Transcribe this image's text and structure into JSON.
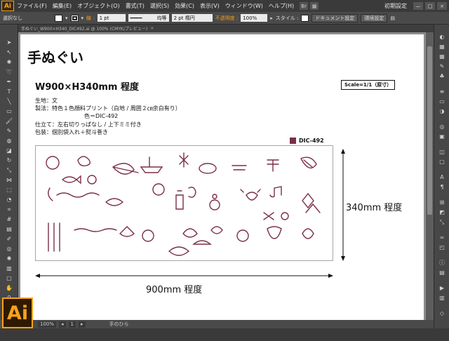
{
  "app": {
    "logo": "Ai",
    "menu": [
      "ファイル(F)",
      "編集(E)",
      "オブジェクト(O)",
      "書式(T)",
      "選択(S)",
      "効果(C)",
      "表示(V)",
      "ウィンドウ(W)",
      "ヘルプ(H)"
    ],
    "workspace": "初期設定",
    "window_buttons": [
      "—",
      "□",
      "×"
    ]
  },
  "control_bar": {
    "selection": "選択なし",
    "stroke_label": "線 :",
    "stroke_weight": "1 pt",
    "stroke_style": "均等",
    "brush": "2 pt 楕円",
    "opacity_label": "不透明度 :",
    "opacity_value": "100%",
    "style_label": "スタイル :",
    "doc_setup": "ドキュメント設定",
    "preferences": "環境設定"
  },
  "tab": {
    "name": "手ぬぐい_W900×H340_DIC492.ai @ 100% (CMYK/プレビュー)"
  },
  "artwork": {
    "title": "手ぬぐい",
    "size_heading": "W900×H340mm 程度",
    "scale": "Scale=1/1（原寸）",
    "spec_lines": [
      "生地：文",
      "製法：特色１色顔料プリント（白地 / 周囲２㎝余白有り）",
      "仕立て：左右切りっぱなし / 上下ミミ付き",
      "包装：個別袋入れ＋熨斗巻き"
    ],
    "spec_color": "色＝DIC-492",
    "ink_label": "DIC-492",
    "ink_color": "#7b2d4a",
    "width_label": "900mm 程度",
    "height_label": "340mm 程度"
  },
  "status": {
    "zoom": "100%",
    "page": "1",
    "tool_name": "手のひら"
  }
}
